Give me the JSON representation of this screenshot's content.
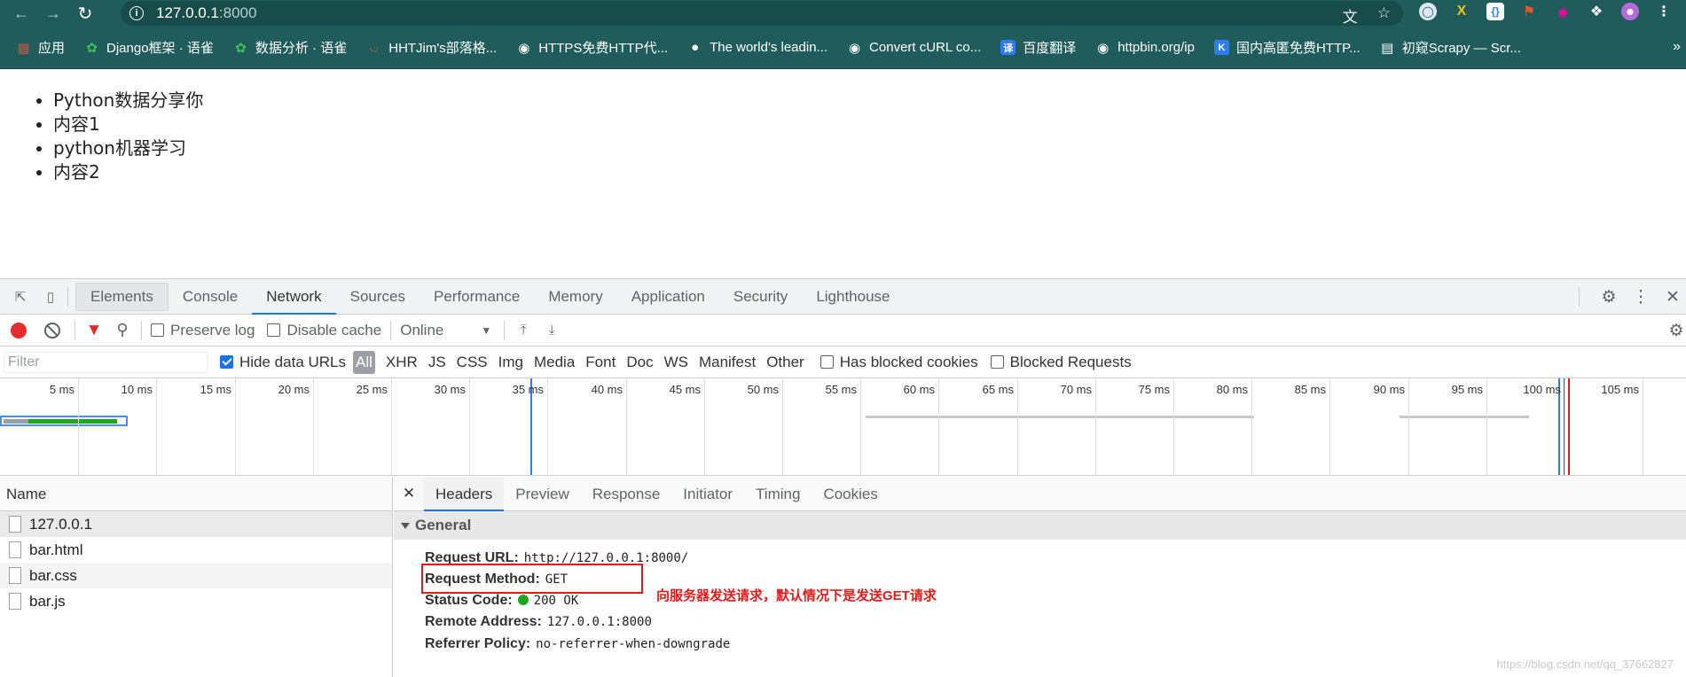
{
  "toolbar": {
    "url_host": "127.0.0.1",
    "url_port": ":8000",
    "translate_icon": "translate-icon",
    "star_icon": "star-icon"
  },
  "bookmarks": [
    {
      "label": "应用",
      "icon": "apps-grid-icon",
      "color": "#e8453c"
    },
    {
      "label": "Django框架 · 语雀",
      "icon": "yuque-leaf-icon",
      "color": "#3cc15a"
    },
    {
      "label": "数据分析 · 语雀",
      "icon": "yuque-leaf-icon",
      "color": "#3cc15a"
    },
    {
      "label": "HHTJim's部落格...",
      "icon": "rainbow-icon",
      "color": "#e4572e"
    },
    {
      "label": "HTTPS免费HTTP代...",
      "icon": "globe-icon",
      "color": "#ffffff"
    },
    {
      "label": "The world's leadin...",
      "icon": "github-icon",
      "color": "#ffffff"
    },
    {
      "label": "Convert cURL co...",
      "icon": "globe-icon",
      "color": "#ffffff"
    },
    {
      "label": "百度翻译",
      "icon": "baidu-translate-icon",
      "color": "#2e7cf6"
    },
    {
      "label": "httpbin.org/ip",
      "icon": "globe-icon",
      "color": "#ffffff"
    },
    {
      "label": "国内高匿免费HTTP...",
      "icon": "kuaidaili-icon",
      "color": "#2e7cf6"
    },
    {
      "label": "初窥Scrapy — Scr...",
      "icon": "document-icon",
      "color": "#ffffff"
    }
  ],
  "page": {
    "items": [
      "Python数据分享你",
      "内容1",
      "python机器学习",
      "内容2"
    ]
  },
  "devtools": {
    "tabs": [
      "Elements",
      "Console",
      "Network",
      "Sources",
      "Performance",
      "Memory",
      "Application",
      "Security",
      "Lighthouse"
    ],
    "selected_tab": "Network",
    "throttle": "Online",
    "preserve_log": "Preserve log",
    "disable_cache": "Disable cache",
    "filter_placeholder": "Filter",
    "hide_data_urls": "Hide data URLs",
    "types": [
      "All",
      "XHR",
      "JS",
      "CSS",
      "Img",
      "Media",
      "Font",
      "Doc",
      "WS",
      "Manifest",
      "Other"
    ],
    "has_blocked_cookies": "Has blocked cookies",
    "blocked_requests": "Blocked Requests",
    "timeline_ticks": [
      "5 ms",
      "10 ms",
      "15 ms",
      "20 ms",
      "25 ms",
      "30 ms",
      "35 ms",
      "40 ms",
      "45 ms",
      "50 ms",
      "55 ms",
      "60 ms",
      "65 ms",
      "70 ms",
      "75 ms",
      "80 ms",
      "85 ms",
      "90 ms",
      "95 ms",
      "100 ms",
      "105 ms"
    ],
    "name_header": "Name",
    "requests": [
      "127.0.0.1",
      "bar.html",
      "bar.css",
      "bar.js"
    ],
    "detail_tabs": [
      "Headers",
      "Preview",
      "Response",
      "Initiator",
      "Timing",
      "Cookies"
    ],
    "general_title": "General",
    "general": {
      "request_url_key": "Request URL:",
      "request_url": "http://127.0.0.1:8000/",
      "method_key": "Request Method:",
      "method": "GET",
      "status_key": "Status Code:",
      "status": "200 OK",
      "remote_key": "Remote Address:",
      "remote": "127.0.0.1:8000",
      "referrer_key": "Referrer Policy:",
      "referrer": "no-referrer-when-downgrade"
    },
    "annotation": "向服务器发送请求，默认情况下是发送GET请求",
    "watermark": "https://blog.csdn.net/qq_37662827"
  },
  "colors": {
    "browser_frame": "#1f5c5b",
    "record": "#e22d2d",
    "accent": "#1a73e8",
    "annotation": "#e01c1c",
    "status_ok": "#1fa51f"
  }
}
